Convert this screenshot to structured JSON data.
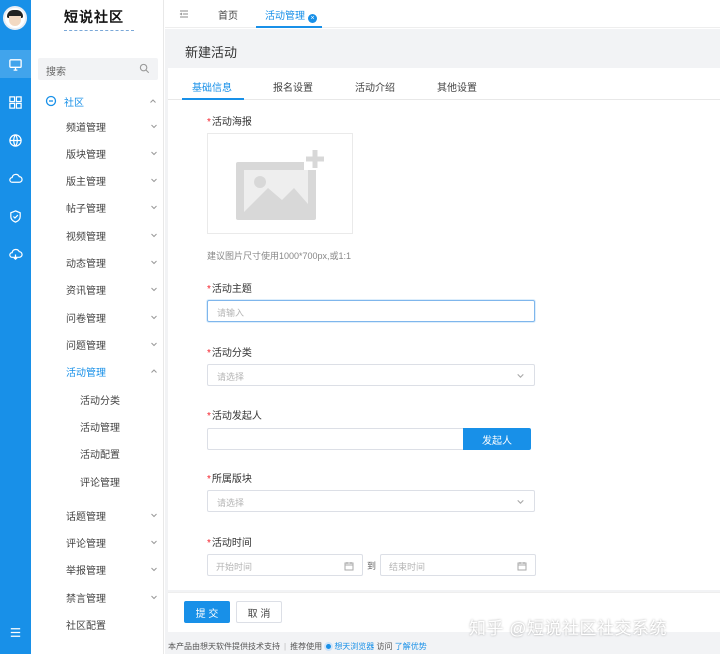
{
  "colors": {
    "accent": "#1890e8",
    "required": "#f5222d",
    "rail": "#1890e8"
  },
  "app": {
    "logo_title": "短说社区"
  },
  "sidebar": {
    "search_placeholder": "搜索",
    "group_label": "社区",
    "items": [
      {
        "label": "频道管理"
      },
      {
        "label": "版块管理"
      },
      {
        "label": "版主管理"
      },
      {
        "label": "帖子管理"
      },
      {
        "label": "视频管理"
      },
      {
        "label": "动态管理"
      },
      {
        "label": "资讯管理"
      },
      {
        "label": "问卷管理"
      },
      {
        "label": "问题管理"
      },
      {
        "label": "活动管理"
      }
    ],
    "activity_sub": [
      {
        "label": "活动分类"
      },
      {
        "label": "活动管理"
      },
      {
        "label": "活动配置"
      },
      {
        "label": "评论管理"
      }
    ],
    "items_after": [
      {
        "label": "话题管理"
      },
      {
        "label": "评论管理"
      },
      {
        "label": "举报管理"
      },
      {
        "label": "禁言管理"
      },
      {
        "label": "社区配置"
      }
    ]
  },
  "topnav": {
    "tabs": [
      {
        "label": "首页"
      },
      {
        "label": "活动管理"
      }
    ]
  },
  "page": {
    "title": "新建活动"
  },
  "form_tabs": [
    {
      "label": "基础信息"
    },
    {
      "label": "报名设置"
    },
    {
      "label": "活动介绍"
    },
    {
      "label": "其他设置"
    }
  ],
  "form": {
    "required_mark": "*",
    "poster_label": "活动海报",
    "poster_hint": "建议图片尺寸使用1000*700px,或1:1",
    "subject_label": "活动主题",
    "subject_placeholder": "请输入",
    "category_label": "活动分类",
    "category_placeholder": "请选择",
    "sponsor_label": "活动发起人",
    "sponsor_button": "发起人",
    "block_label": "所属版块",
    "block_placeholder": "请选择",
    "time_label": "活动时间",
    "start_placeholder": "开始时间",
    "to_text": "到",
    "end_placeholder": "结束时间"
  },
  "actions": {
    "submit": "提 交",
    "cancel": "取 消"
  },
  "footer": {
    "support_text": "本产品由想天软件提供技术支持",
    "recommend_text": "推荐使用",
    "browser_name": "想天浏览器",
    "visit_text": "访问",
    "learn_link": "了解优势"
  },
  "watermark": "知乎 @短说社区社交系统"
}
